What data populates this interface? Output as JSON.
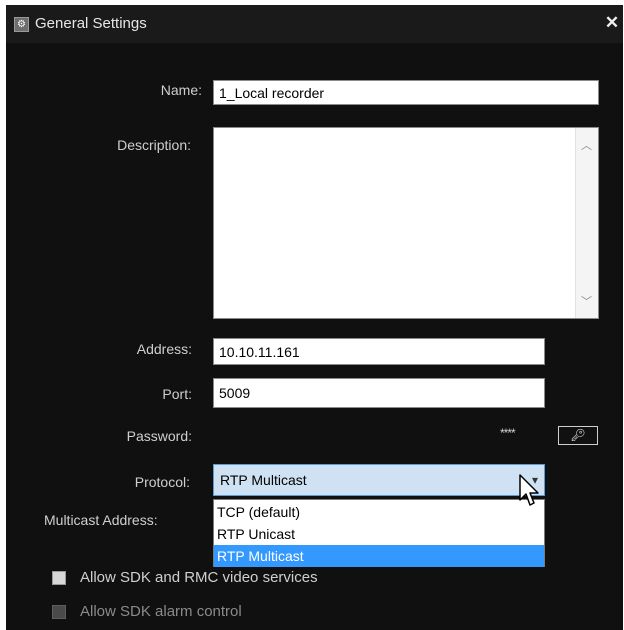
{
  "window": {
    "title": "General Settings",
    "close_glyph": "✕"
  },
  "form": {
    "name_label": "Name:",
    "name_value": "1_Local recorder",
    "description_label": "Description:",
    "description_value": "",
    "address_label": "Address:",
    "address_value": "10.10.11.161",
    "port_label": "Port:",
    "port_value": "5009",
    "password_label": "Password:",
    "password_mask": "****",
    "protocol_label": "Protocol:",
    "protocol_selected": "RTP Multicast",
    "protocol_options": [
      "TCP (default)",
      "RTP Unicast",
      "RTP Multicast"
    ],
    "multicast_label": "Multicast Address:"
  },
  "checkboxes": [
    {
      "label": "Allow SDK and RMC video services",
      "checked": false,
      "enabled": true
    },
    {
      "label": "Allow SDK alarm control",
      "checked": false,
      "enabled": false
    }
  ],
  "icons": {
    "app": "settings-gear-icon",
    "close": "close-icon",
    "key_button": "key-icon",
    "dropdown": "chevron-down-icon",
    "scroll_up": "chevron-up-icon",
    "scroll_down": "chevron-down-icon",
    "cursor": "mouse-pointer-icon"
  },
  "colors": {
    "dialog_background": "#101010",
    "selected_option": "#3399ff",
    "select_highlight": "#cfe2f4"
  }
}
